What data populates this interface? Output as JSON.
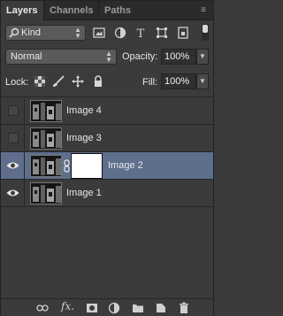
{
  "tabs": [
    {
      "label": "Layers"
    },
    {
      "label": "Channels"
    },
    {
      "label": "Paths"
    }
  ],
  "panel_menu_icon": "panel-menu-icon",
  "filter": {
    "kind_label": "Kind",
    "icons": [
      "pixel-filter-icon",
      "adjustment-filter-icon",
      "type-filter-icon",
      "shape-filter-icon",
      "smart-object-filter-icon"
    ]
  },
  "blend": {
    "mode": "Normal",
    "opacity_label": "Opacity:",
    "opacity_value": "100%"
  },
  "lock": {
    "label": "Lock:",
    "icons": [
      "lock-transparent-icon",
      "lock-paint-icon",
      "lock-position-icon",
      "lock-all-icon"
    ],
    "fill_label": "Fill:",
    "fill_value": "100%"
  },
  "layers": [
    {
      "name": "Image 4",
      "visible": false,
      "selected": false,
      "has_mask": false
    },
    {
      "name": "Image 3",
      "visible": false,
      "selected": false,
      "has_mask": false
    },
    {
      "name": "Image 2",
      "visible": true,
      "selected": true,
      "has_mask": true
    },
    {
      "name": "Image 1",
      "visible": true,
      "selected": false,
      "has_mask": false
    }
  ],
  "bottom_toolbar": {
    "fx_label": "fx.",
    "icons": [
      "link-layers-icon",
      "fx-icon",
      "add-mask-icon",
      "adjustment-layer-icon",
      "new-group-icon",
      "new-layer-icon",
      "trash-icon"
    ]
  },
  "colors": {
    "selected_row": "#5e6e8c",
    "panel_bg": "#3b3b3b"
  }
}
